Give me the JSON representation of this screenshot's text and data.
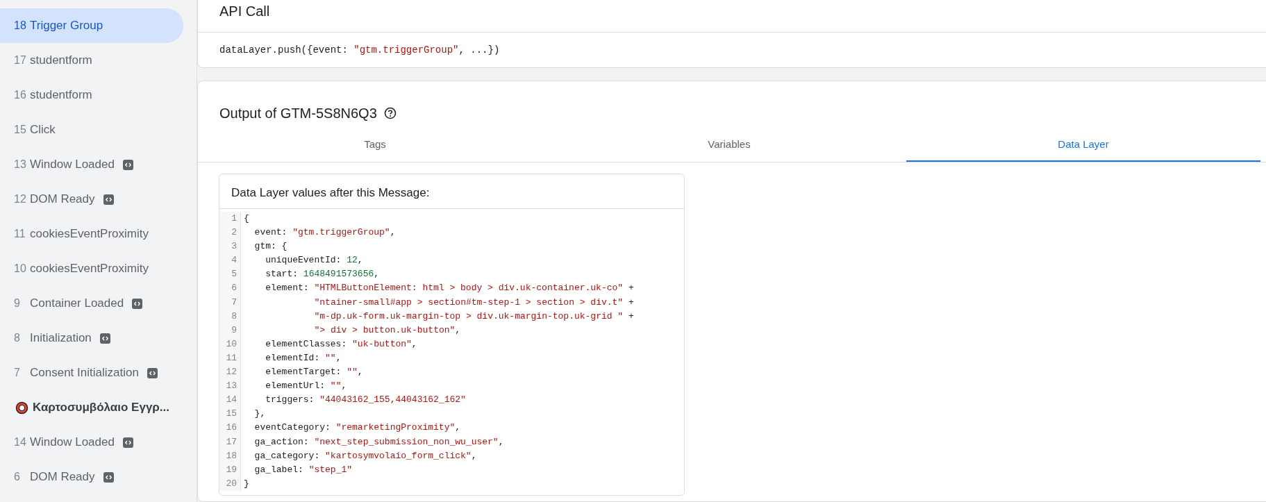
{
  "sidebar": {
    "items": [
      {
        "kind": "event",
        "number": "18",
        "name": "Trigger Group",
        "has_icon": false,
        "selected": true
      },
      {
        "kind": "event",
        "number": "17",
        "name": "studentform",
        "has_icon": false,
        "selected": false
      },
      {
        "kind": "event",
        "number": "16",
        "name": "studentform",
        "has_icon": false,
        "selected": false
      },
      {
        "kind": "event",
        "number": "15",
        "name": "Click",
        "has_icon": false,
        "selected": false
      },
      {
        "kind": "event",
        "number": "13",
        "name": "Window Loaded",
        "has_icon": true,
        "selected": false
      },
      {
        "kind": "event",
        "number": "12",
        "name": "DOM Ready",
        "has_icon": true,
        "selected": false
      },
      {
        "kind": "event",
        "number": "11",
        "name": "cookiesEventProximity",
        "has_icon": false,
        "selected": false
      },
      {
        "kind": "event",
        "number": "10",
        "name": "cookiesEventProximity",
        "has_icon": false,
        "selected": false
      },
      {
        "kind": "event",
        "number": "9",
        "name": "Container Loaded",
        "has_icon": true,
        "selected": false
      },
      {
        "kind": "event",
        "number": "8",
        "name": "Initialization",
        "has_icon": true,
        "selected": false
      },
      {
        "kind": "event",
        "number": "7",
        "name": "Consent Initialization",
        "has_icon": true,
        "selected": false
      },
      {
        "kind": "page",
        "name": "Καρτοσυμβόλαιο Εγγρ...",
        "selected": false
      },
      {
        "kind": "event",
        "number": "14",
        "name": "Window Loaded",
        "has_icon": true,
        "selected": false
      },
      {
        "kind": "event",
        "number": "6",
        "name": "DOM Ready",
        "has_icon": true,
        "selected": false
      }
    ]
  },
  "api_call": {
    "title": "API Call",
    "code": [
      {
        "kind": "plain",
        "text": "dataLayer.push({event: "
      },
      {
        "kind": "string",
        "text": "\"gtm.triggerGroup\""
      },
      {
        "kind": "plain",
        "text": ", ...})"
      }
    ]
  },
  "output": {
    "title": "Output of GTM-5S8N6Q3",
    "tabs": [
      {
        "label": "Tags",
        "selected": false
      },
      {
        "label": "Variables",
        "selected": false
      },
      {
        "label": "Data Layer",
        "selected": true
      }
    ],
    "data_layer": {
      "title": "Data Layer values after this Message:",
      "lines": [
        {
          "number": "1",
          "continuation": false,
          "tokens": [
            {
              "kind": "plain",
              "text": "{"
            }
          ]
        },
        {
          "number": "2",
          "continuation": false,
          "tokens": [
            {
              "kind": "plain",
              "text": "  event: "
            },
            {
              "kind": "string",
              "text": "\"gtm.triggerGroup\""
            },
            {
              "kind": "plain",
              "text": ","
            }
          ]
        },
        {
          "number": "3",
          "continuation": false,
          "tokens": [
            {
              "kind": "plain",
              "text": "  gtm: {"
            }
          ]
        },
        {
          "number": "4",
          "continuation": false,
          "tokens": [
            {
              "kind": "plain",
              "text": "    uniqueEventId: "
            },
            {
              "kind": "number",
              "text": "12"
            },
            {
              "kind": "plain",
              "text": ","
            }
          ]
        },
        {
          "number": "5",
          "continuation": false,
          "tokens": [
            {
              "kind": "plain",
              "text": "    start: "
            },
            {
              "kind": "number",
              "text": "1648491573656"
            },
            {
              "kind": "plain",
              "text": ","
            }
          ]
        },
        {
          "number": "6",
          "continuation": false,
          "tokens": [
            {
              "kind": "plain",
              "text": "    element: "
            },
            {
              "kind": "string",
              "text": "\"HTMLButtonElement: html > body > div.uk-container.uk-co\""
            },
            {
              "kind": "plain",
              "text": " +"
            }
          ]
        },
        {
          "number": "7",
          "continuation": true,
          "tokens": [
            {
              "kind": "string",
              "text": "\"ntainer-small#app > section#tm-step-1 > section > div.t\""
            },
            {
              "kind": "plain",
              "text": " +"
            }
          ]
        },
        {
          "number": "8",
          "continuation": true,
          "tokens": [
            {
              "kind": "string",
              "text": "\"m-dp.uk-form.uk-margin-top > div.uk-margin-top.uk-grid \""
            },
            {
              "kind": "plain",
              "text": " +"
            }
          ]
        },
        {
          "number": "9",
          "continuation": true,
          "tokens": [
            {
              "kind": "string",
              "text": "\"> div > button.uk-button\""
            },
            {
              "kind": "plain",
              "text": ","
            }
          ]
        },
        {
          "number": "10",
          "continuation": false,
          "tokens": [
            {
              "kind": "plain",
              "text": "    elementClasses: "
            },
            {
              "kind": "string",
              "text": "\"uk-button\""
            },
            {
              "kind": "plain",
              "text": ","
            }
          ]
        },
        {
          "number": "11",
          "continuation": false,
          "tokens": [
            {
              "kind": "plain",
              "text": "    elementId: "
            },
            {
              "kind": "string",
              "text": "\"\""
            },
            {
              "kind": "plain",
              "text": ","
            }
          ]
        },
        {
          "number": "12",
          "continuation": false,
          "tokens": [
            {
              "kind": "plain",
              "text": "    elementTarget: "
            },
            {
              "kind": "string",
              "text": "\"\""
            },
            {
              "kind": "plain",
              "text": ","
            }
          ]
        },
        {
          "number": "13",
          "continuation": false,
          "tokens": [
            {
              "kind": "plain",
              "text": "    elementUrl: "
            },
            {
              "kind": "string",
              "text": "\"\""
            },
            {
              "kind": "plain",
              "text": ","
            }
          ]
        },
        {
          "number": "14",
          "continuation": false,
          "tokens": [
            {
              "kind": "plain",
              "text": "    triggers: "
            },
            {
              "kind": "string",
              "text": "\"44043162_155,44043162_162\""
            }
          ]
        },
        {
          "number": "15",
          "continuation": false,
          "tokens": [
            {
              "kind": "plain",
              "text": "  },"
            }
          ]
        },
        {
          "number": "16",
          "continuation": false,
          "tokens": [
            {
              "kind": "plain",
              "text": "  eventCategory: "
            },
            {
              "kind": "string",
              "text": "\"remarketingProximity\""
            },
            {
              "kind": "plain",
              "text": ","
            }
          ]
        },
        {
          "number": "17",
          "continuation": false,
          "tokens": [
            {
              "kind": "plain",
              "text": "  ga_action: "
            },
            {
              "kind": "string",
              "text": "\"next_step_submission_non_wu_user\""
            },
            {
              "kind": "plain",
              "text": ","
            }
          ]
        },
        {
          "number": "18",
          "continuation": false,
          "tokens": [
            {
              "kind": "plain",
              "text": "  ga_category: "
            },
            {
              "kind": "string",
              "text": "\"kartosymvolaio_form_click\""
            },
            {
              "kind": "plain",
              "text": ","
            }
          ]
        },
        {
          "number": "19",
          "continuation": false,
          "tokens": [
            {
              "kind": "plain",
              "text": "  ga_label: "
            },
            {
              "kind": "string",
              "text": "\"step_1\""
            }
          ]
        },
        {
          "number": "20",
          "continuation": false,
          "tokens": [
            {
              "kind": "plain",
              "text": "}"
            }
          ]
        }
      ]
    }
  }
}
